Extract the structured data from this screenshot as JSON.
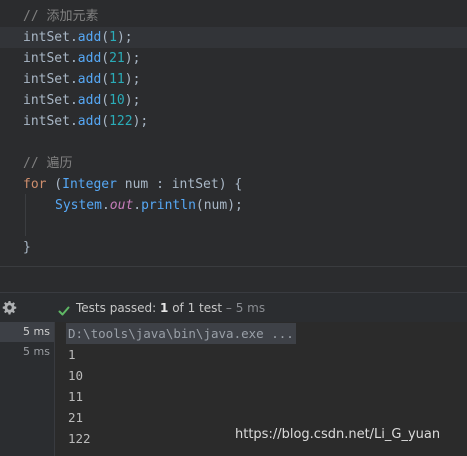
{
  "editor": {
    "comment1": "// 添加元素",
    "adds": [
      {
        "obj": "intSet",
        "method": "add",
        "arg": "1"
      },
      {
        "obj": "intSet",
        "method": "add",
        "arg": "21"
      },
      {
        "obj": "intSet",
        "method": "add",
        "arg": "11"
      },
      {
        "obj": "intSet",
        "method": "add",
        "arg": "10"
      },
      {
        "obj": "intSet",
        "method": "add",
        "arg": "122"
      }
    ],
    "comment2": "// 遍历",
    "for_kw": "for",
    "for_type": "Integer",
    "for_var": "num",
    "for_iter": "intSet",
    "print_class": "System",
    "print_field": "out",
    "print_method": "println",
    "print_arg": "num",
    "close_brace": "}"
  },
  "run": {
    "status_label": "Tests passed: ",
    "passed_count": "1",
    "of_text": " of 1 test",
    "duration": " – 5 ms",
    "tree_rows": [
      "5 ms",
      "5 ms"
    ],
    "console_command": "D:\\tools\\java\\bin\\java.exe ...",
    "console_output": [
      "1",
      "10",
      "11",
      "21",
      "122"
    ]
  },
  "watermark": "https://blog.csdn.net/Li_G_yuan",
  "colors": {
    "editor_bg": "#2b2c2e",
    "keyword": "#cf8e6d",
    "method": "#56a8f5",
    "number": "#2aacb8",
    "pass_green": "#5fb865"
  },
  "icons": [
    "gear-icon",
    "check-icon"
  ]
}
